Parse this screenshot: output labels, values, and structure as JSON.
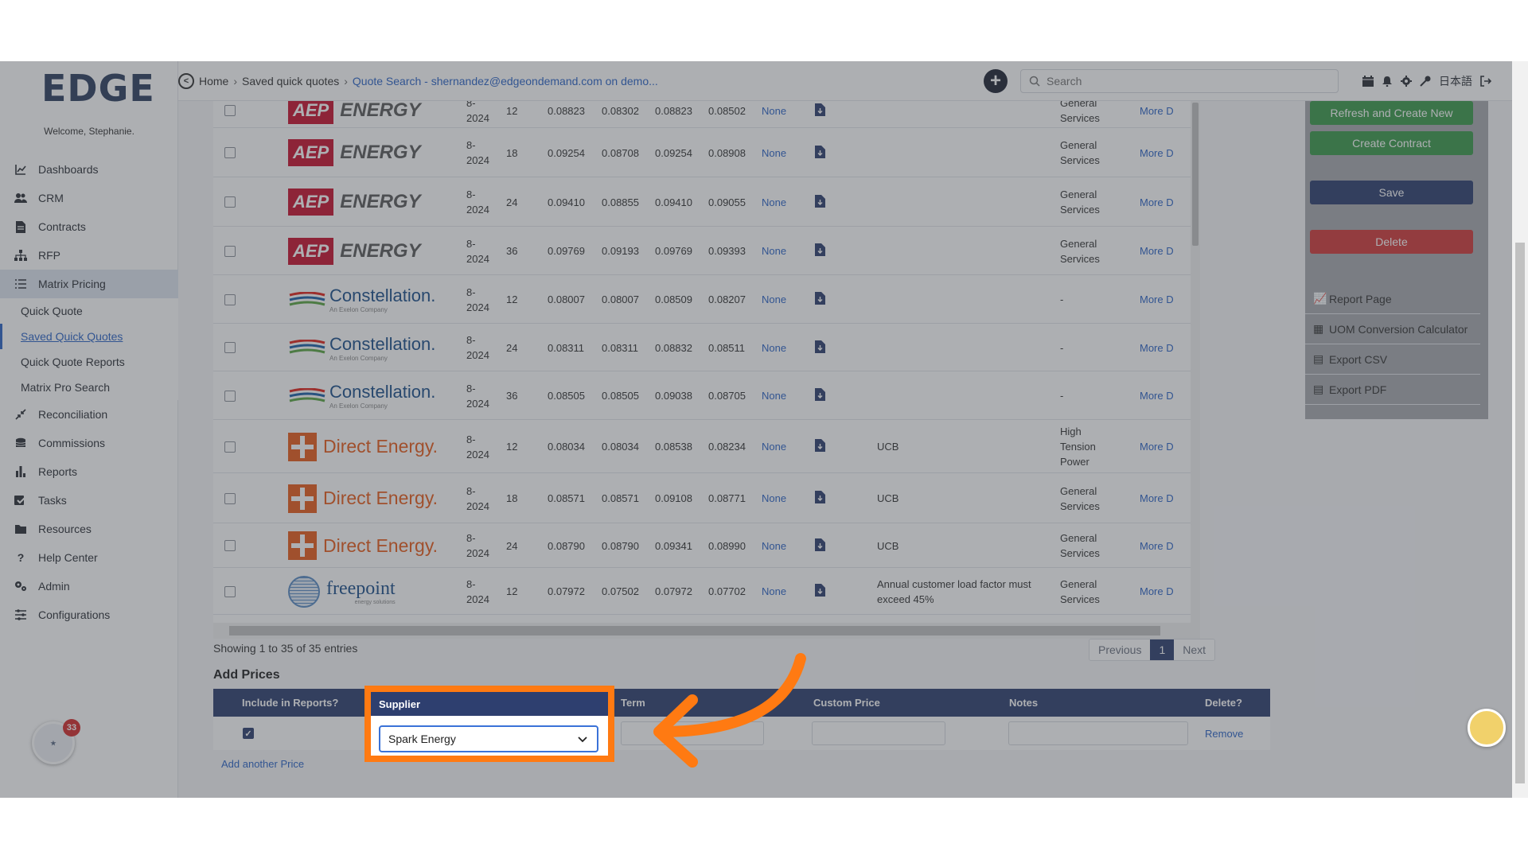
{
  "app": {
    "logo": "EDGE",
    "welcome": "Welcome, Stephanie."
  },
  "sidebar": {
    "items": [
      {
        "label": "Dashboards",
        "icon": "chart-line-icon"
      },
      {
        "label": "CRM",
        "icon": "users-icon"
      },
      {
        "label": "Contracts",
        "icon": "contract-icon"
      },
      {
        "label": "RFP",
        "icon": "sitemap-icon"
      },
      {
        "label": "Matrix Pricing",
        "icon": "list-icon"
      },
      {
        "label": "Reconciliation",
        "icon": "compress-icon"
      },
      {
        "label": "Commissions",
        "icon": "coins-icon"
      },
      {
        "label": "Reports",
        "icon": "bar-chart-icon"
      },
      {
        "label": "Tasks",
        "icon": "tasks-icon"
      },
      {
        "label": "Resources",
        "icon": "folder-icon"
      },
      {
        "label": "Help Center",
        "icon": "question-icon"
      },
      {
        "label": "Admin",
        "icon": "cogs-icon"
      },
      {
        "label": "Configurations",
        "icon": "sliders-icon"
      }
    ],
    "sub_items": [
      "Quick Quote",
      "Saved Quick Quotes",
      "Quick Quote Reports",
      "Matrix Pro Search"
    ],
    "badge_count": "33"
  },
  "topbar": {
    "crumbs": [
      "Home",
      "Saved quick quotes",
      "Quote Search - shernandez@edgeondemand.com on demo..."
    ],
    "search_placeholder": "Search",
    "lang": "日本語"
  },
  "table": {
    "rows": [
      {
        "supplier": "AEP ENERGY",
        "date": "8-\n2024",
        "term": "12",
        "p1": "0.08823",
        "p2": "0.08302",
        "p3": "0.08823",
        "p4": "0.08502",
        "none": "None",
        "note": "",
        "product": "General Services",
        "more": "More D"
      },
      {
        "supplier": "AEP ENERGY",
        "date": "8-\n2024",
        "term": "18",
        "p1": "0.09254",
        "p2": "0.08708",
        "p3": "0.09254",
        "p4": "0.08908",
        "none": "None",
        "note": "",
        "product": "General Services",
        "more": "More D"
      },
      {
        "supplier": "AEP ENERGY",
        "date": "8-\n2024",
        "term": "24",
        "p1": "0.09410",
        "p2": "0.08855",
        "p3": "0.09410",
        "p4": "0.09055",
        "none": "None",
        "note": "",
        "product": "General Services",
        "more": "More D"
      },
      {
        "supplier": "AEP ENERGY",
        "date": "8-\n2024",
        "term": "36",
        "p1": "0.09769",
        "p2": "0.09193",
        "p3": "0.09769",
        "p4": "0.09393",
        "none": "None",
        "note": "",
        "product": "General Services",
        "more": "More D"
      },
      {
        "supplier": "Constellation.",
        "date": "8-\n2024",
        "term": "12",
        "p1": "0.08007",
        "p2": "0.08007",
        "p3": "0.08509",
        "p4": "0.08207",
        "none": "None",
        "note": "",
        "product": "-",
        "more": "More D"
      },
      {
        "supplier": "Constellation.",
        "date": "8-\n2024",
        "term": "24",
        "p1": "0.08311",
        "p2": "0.08311",
        "p3": "0.08832",
        "p4": "0.08511",
        "none": "None",
        "note": "",
        "product": "-",
        "more": "More D"
      },
      {
        "supplier": "Constellation.",
        "date": "8-\n2024",
        "term": "36",
        "p1": "0.08505",
        "p2": "0.08505",
        "p3": "0.09038",
        "p4": "0.08705",
        "none": "None",
        "note": "",
        "product": "-",
        "more": "More D"
      },
      {
        "supplier": "Direct Energy.",
        "date": "8-\n2024",
        "term": "12",
        "p1": "0.08034",
        "p2": "0.08034",
        "p3": "0.08538",
        "p4": "0.08234",
        "none": "None",
        "note": "UCB",
        "product": "High Tension Power",
        "more": "More D"
      },
      {
        "supplier": "Direct Energy.",
        "date": "8-\n2024",
        "term": "18",
        "p1": "0.08571",
        "p2": "0.08571",
        "p3": "0.09108",
        "p4": "0.08771",
        "none": "None",
        "note": "UCB",
        "product": "General Services",
        "more": "More D"
      },
      {
        "supplier": "Direct Energy.",
        "date": "8-\n2024",
        "term": "24",
        "p1": "0.08790",
        "p2": "0.08790",
        "p3": "0.09341",
        "p4": "0.08990",
        "none": "None",
        "note": "UCB",
        "product": "General Services",
        "more": "More D"
      },
      {
        "supplier": "freepoint",
        "date": "8-\n2024",
        "term": "12",
        "p1": "0.07972",
        "p2": "0.07502",
        "p3": "0.07972",
        "p4": "0.07702",
        "none": "None",
        "note": "Annual customer load factor must exceed 45%",
        "product": "General Services",
        "more": "More D"
      }
    ],
    "constellation_tag": "An Exelon Company",
    "freepoint_tag": "energy solutions",
    "info": "Showing 1 to 35 of 35 entries",
    "pager": {
      "prev": "Previous",
      "page": "1",
      "next": "Next"
    }
  },
  "add_prices": {
    "title": "Add Prices",
    "headers": {
      "include": "Include in Reports?",
      "supplier": "Supplier",
      "term": "Term",
      "custom_price": "Custom Price",
      "notes": "Notes",
      "delete": "Delete?"
    },
    "supplier_value": "Spark Energy",
    "remove": "Remove",
    "add_another": "Add another Price"
  },
  "right_panel": {
    "refresh": "Refresh and Create New",
    "create_contract": "Create Contract",
    "save": "Save",
    "delete": "Delete",
    "links": [
      "Report Page",
      "UOM Conversion Calculator",
      "Export CSV",
      "Export PDF"
    ]
  },
  "colors": {
    "green": "#3c9a4a",
    "navy": "#2e3f6f",
    "red": "#d23a3a",
    "highlight": "#ff7a12",
    "link": "#2c64c7"
  }
}
